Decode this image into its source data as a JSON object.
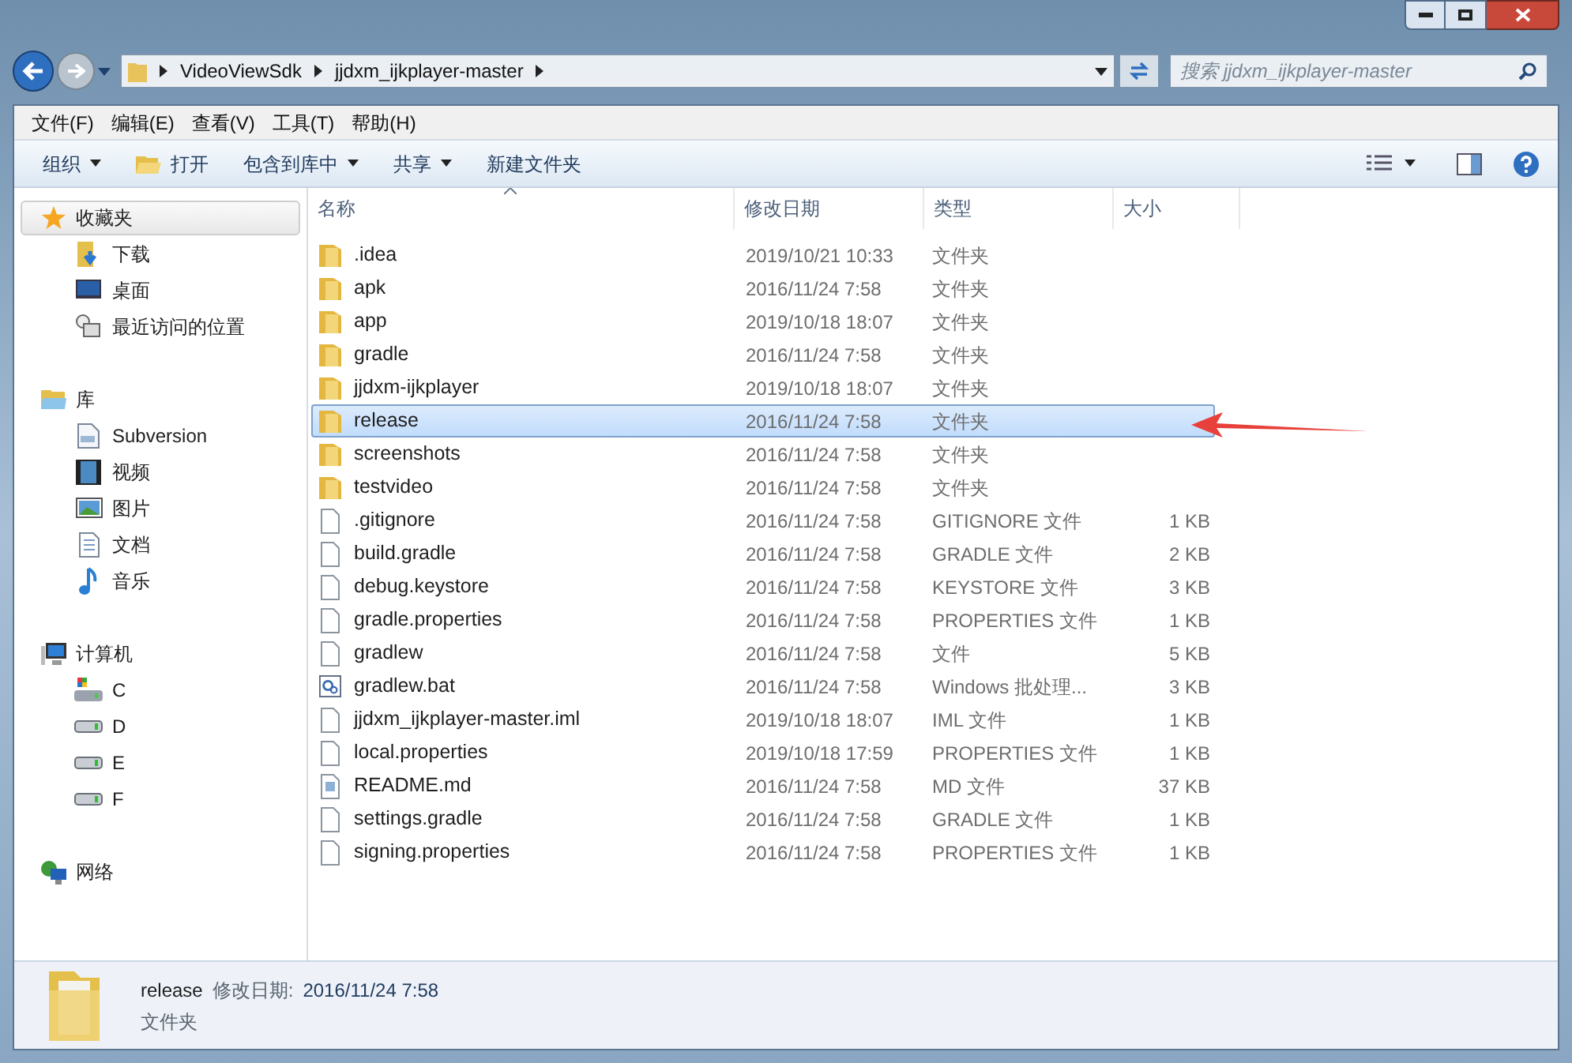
{
  "address_bar": {
    "crumbs": [
      "VideoViewSdk",
      "jjdxm_ijkplayer-master"
    ]
  },
  "search": {
    "placeholder": "搜索 jjdxm_ijkplayer-master"
  },
  "menu": [
    "文件(F)",
    "编辑(E)",
    "查看(V)",
    "工具(T)",
    "帮助(H)"
  ],
  "toolbar": [
    {
      "label": "组织",
      "kind": "dropdown"
    },
    {
      "label": "打开",
      "kind": "icon"
    },
    {
      "label": "包含到库中",
      "kind": "dropdown"
    },
    {
      "label": "共享",
      "kind": "dropdown"
    },
    {
      "label": "新建文件夹",
      "kind": "plain"
    }
  ],
  "sidebar": [
    {
      "label": "收藏夹",
      "selected": true,
      "children": [
        {
          "label": "下载"
        },
        {
          "label": "桌面"
        },
        {
          "label": "最近访问的位置"
        }
      ]
    },
    {
      "label": "库",
      "selected": false,
      "children": [
        {
          "label": "Subversion"
        },
        {
          "label": "视频"
        },
        {
          "label": "图片"
        },
        {
          "label": "文档"
        },
        {
          "label": "音乐"
        }
      ]
    },
    {
      "label": "计算机",
      "selected": false,
      "children": [
        {
          "label": "C"
        },
        {
          "label": "D"
        },
        {
          "label": "E"
        },
        {
          "label": "F"
        }
      ]
    },
    {
      "label": "网络",
      "selected": false
    }
  ],
  "table": {
    "columns": [
      "名称",
      "修改日期",
      "类型",
      "大小"
    ],
    "rows": [
      {
        "name": ".idea",
        "date": "2019/10/21 10:33",
        "type": "文件夹",
        "kind": "folder",
        "selected": false
      },
      {
        "name": "apk",
        "date": "2016/11/24 7:58",
        "type": "文件夹",
        "kind": "folder",
        "selected": false
      },
      {
        "name": "app",
        "date": "2019/10/18 18:07",
        "type": "文件夹",
        "kind": "folder",
        "selected": false
      },
      {
        "name": "gradle",
        "date": "2016/11/24 7:58",
        "type": "文件夹",
        "kind": "folder",
        "selected": false
      },
      {
        "name": "jjdxm-ijkplayer",
        "date": "2019/10/18 18:07",
        "type": "文件夹",
        "kind": "folder",
        "selected": false
      },
      {
        "name": "release",
        "date": "2016/11/24 7:58",
        "type": "文件夹",
        "kind": "folder",
        "selected": true
      },
      {
        "name": "screenshots",
        "date": "2016/11/24 7:58",
        "type": "文件夹",
        "kind": "folder",
        "selected": false
      },
      {
        "name": "testvideo",
        "date": "2016/11/24 7:58",
        "type": "文件夹",
        "kind": "folder",
        "selected": false
      },
      {
        "name": ".gitignore",
        "date": "2016/11/24 7:58",
        "type": "GITIGNORE 文件",
        "size": "1 KB",
        "kind": "file",
        "selected": false
      },
      {
        "name": "build.gradle",
        "date": "2016/11/24 7:58",
        "type": "GRADLE 文件",
        "size": "2 KB",
        "kind": "file",
        "selected": false
      },
      {
        "name": "debug.keystore",
        "date": "2016/11/24 7:58",
        "type": "KEYSTORE 文件",
        "size": "3 KB",
        "kind": "file",
        "selected": false
      },
      {
        "name": "gradle.properties",
        "date": "2016/11/24 7:58",
        "type": "PROPERTIES 文件",
        "size": "1 KB",
        "kind": "file",
        "selected": false
      },
      {
        "name": "gradlew",
        "date": "2016/11/24 7:58",
        "type": "文件",
        "size": "5 KB",
        "kind": "file",
        "selected": false
      },
      {
        "name": "gradlew.bat",
        "date": "2016/11/24 7:58",
        "type": "Windows 批处理...",
        "size": "3 KB",
        "kind": "batch",
        "selected": false
      },
      {
        "name": "jjdxm_ijkplayer-master.iml",
        "date": "2019/10/18 18:07",
        "type": "IML 文件",
        "size": "1 KB",
        "kind": "file",
        "selected": false
      },
      {
        "name": "local.properties",
        "date": "2019/10/18 17:59",
        "type": "PROPERTIES 文件",
        "size": "1 KB",
        "kind": "file",
        "selected": false
      },
      {
        "name": "README.md",
        "date": "2016/11/24 7:58",
        "type": "MD 文件",
        "size": "37 KB",
        "kind": "document",
        "selected": false
      },
      {
        "name": "settings.gradle",
        "date": "2016/11/24 7:58",
        "type": "GRADLE 文件",
        "size": "1 KB",
        "kind": "file",
        "selected": false
      },
      {
        "name": "signing.properties",
        "date": "2016/11/24 7:58",
        "type": "PROPERTIES 文件",
        "size": "1 KB",
        "kind": "file",
        "selected": false
      }
    ]
  },
  "details": {
    "name": "release",
    "date_label": "修改日期:",
    "date": "2016/11/24 7:58",
    "type": "文件夹"
  }
}
